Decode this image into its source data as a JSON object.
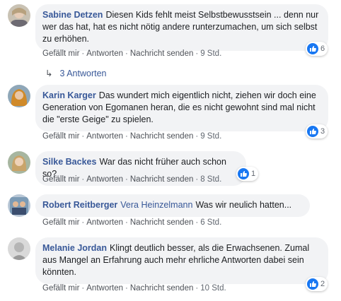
{
  "actions": {
    "like": "Gefällt mir",
    "reply": "Antworten",
    "message": "Nachricht senden",
    "separator": "·"
  },
  "comments": [
    {
      "name": "Sabine Detzen",
      "text": "Diesen Kids fehlt meist Selbstbewusstsein ... denn nur wer das hat, hat es nicht nötig andere runterzumachen, um sich selbst zu erhöhen.",
      "time": "9 Std.",
      "reactions": "6",
      "replies": "3 Antworten"
    },
    {
      "name": "Karin Karger",
      "text": "Das wundert mich eigentlich nicht, ziehen wir doch eine Generation von Egomanen heran, die es nicht gewohnt sind mal nicht die \"erste Geige\" zu spielen.",
      "time": "9 Std.",
      "reactions": "3"
    },
    {
      "name": "Silke Backes",
      "text": "War das nicht früher auch schon so?",
      "time": "8 Std.",
      "reactions": "1"
    },
    {
      "name": "Robert Reitberger",
      "tag": "Vera Heinzelmann",
      "text": "Was wir neulich hatten...",
      "time": "6 Std."
    },
    {
      "name": "Melanie Jordan",
      "text": "Klingt deutlich besser, als die Erwachsenen. Zumal aus Mangel an Erfahrung auch mehr ehrliche Antworten dabei sein könnten.",
      "time": "10 Std.",
      "reactions": "2"
    }
  ],
  "colors": {
    "link": "#385898",
    "bubble": "#f2f3f5",
    "like": "#1877f2",
    "meta": "#616770"
  },
  "icons": [
    "like-icon",
    "reply-arrow-icon"
  ]
}
